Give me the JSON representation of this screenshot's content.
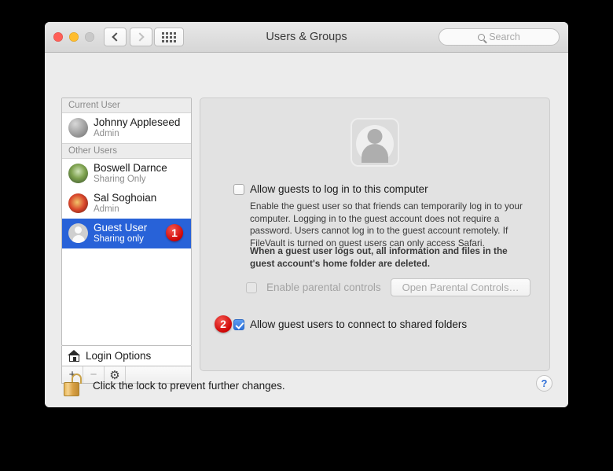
{
  "window": {
    "title": "Users & Groups",
    "traffic_lights": [
      "close",
      "minimize",
      "zoom"
    ],
    "search": {
      "placeholder": "Search"
    }
  },
  "sidebar": {
    "sections": [
      {
        "header": "Current User",
        "users": [
          {
            "name": "Johnny Appleseed",
            "role": "Admin",
            "avatar": "johnny",
            "selected": false,
            "badge": ""
          }
        ]
      },
      {
        "header": "Other Users",
        "users": [
          {
            "name": "Boswell Darnce",
            "role": "Sharing Only",
            "avatar": "boswell",
            "selected": false,
            "badge": ""
          },
          {
            "name": "Sal Soghoian",
            "role": "Admin",
            "avatar": "sal",
            "selected": false,
            "badge": ""
          },
          {
            "name": "Guest User",
            "role": "Sharing only",
            "avatar": "guest",
            "selected": true,
            "badge": "1"
          }
        ]
      }
    ],
    "login_options": "Login Options",
    "buttons": {
      "add": "+",
      "remove": "−",
      "settings": "⚙"
    }
  },
  "main": {
    "allow_guest_login": {
      "label": "Allow guests to log in to this computer",
      "checked": false
    },
    "description": "Enable the guest user so that friends can temporarily log in to your computer. Logging in to the guest account does not require a password. Users cannot log in to the guest account remotely. If FileVault is turned on guest users can only access Safari.",
    "description_bold": "When a guest user logs out, all information and files in the guest account's home folder are deleted.",
    "parental_controls": {
      "checkbox_label": "Enable parental controls",
      "checked": false,
      "button_label": "Open Parental Controls…",
      "enabled": false
    },
    "shared_folders": {
      "label": "Allow guest users to connect to shared folders",
      "checked": true,
      "badge": "2"
    }
  },
  "footer": {
    "lock_text": "Click the lock to prevent further changes.",
    "help_label": "?"
  },
  "colors": {
    "selection_blue": "#2862d8",
    "badge_red": "#cc0000",
    "checkbox_blue": "#2f72da",
    "window_bg": "#ececec",
    "panel_bg": "#e2e2e2",
    "desktop_bg": "#000000"
  }
}
